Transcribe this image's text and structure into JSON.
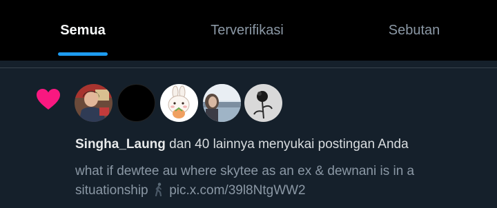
{
  "tabs": [
    {
      "label": "Semua",
      "active": true
    },
    {
      "label": "Terverifikasi",
      "active": false
    },
    {
      "label": "Sebutan",
      "active": false
    }
  ],
  "notification": {
    "type_icon": "heart-icon",
    "icon_color": "#f91880",
    "avatars": [
      "user-avatar",
      "user-avatar",
      "user-avatar",
      "user-avatar",
      "user-avatar"
    ],
    "username": "Singha_Laung",
    "summary_rest": " dan 40 lainnya menyukai postingan Anda",
    "post_text": "what if dewtee au where skytee as an ex & dewnani is in a situationship",
    "post_emoji": "person-walking-icon",
    "post_link": "pic.x.com/39l8NtgWW2"
  },
  "colors": {
    "background": "#15202b",
    "tabbar": "#000000",
    "accent": "#1d9bf0",
    "muted_text": "#8b98a5"
  }
}
